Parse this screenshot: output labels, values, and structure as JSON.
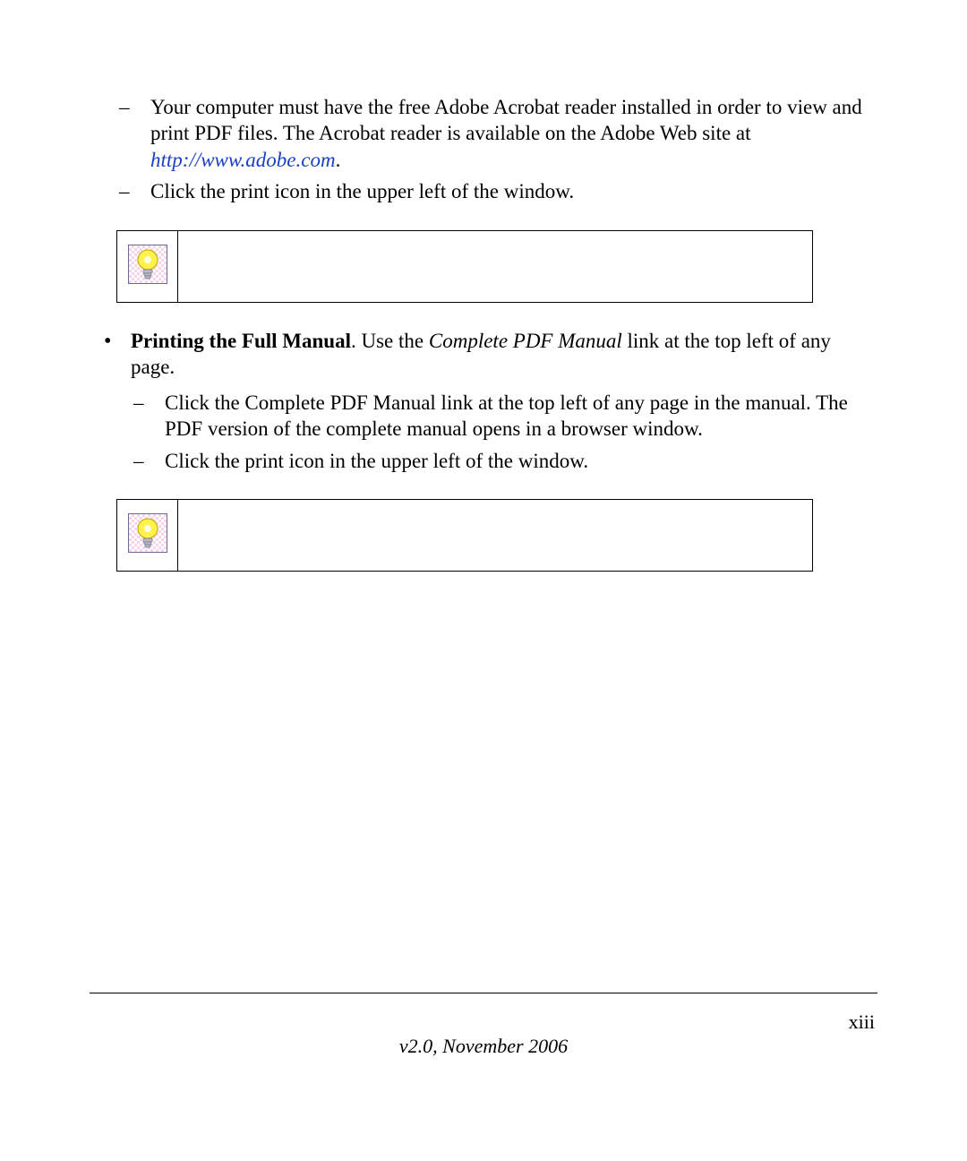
{
  "list1": {
    "item1_prefix": "Your computer must have the free Adobe Acrobat reader installed in order to view and print PDF files. The Acrobat reader is available on the Adobe Web site at ",
    "item1_link": "http://www.adobe.com",
    "item1_suffix": ".",
    "item2": "Click the print icon in the upper left of the window."
  },
  "bullet2": {
    "bold": "Printing the Full Manual",
    "mid1": ". Use the ",
    "italic": "Complete PDF Manual",
    "mid2": " link at the top left of any page."
  },
  "list2": {
    "item1": "Click the Complete PDF Manual link at the top left of any page in the manual. The PDF version of the complete manual opens in a browser window.",
    "item2": "Click the print icon in the upper left of the window."
  },
  "footer": {
    "page": "xiii",
    "version": "v2.0, November 2006"
  },
  "icons": {
    "tip": "tip-lightbulb-icon"
  }
}
